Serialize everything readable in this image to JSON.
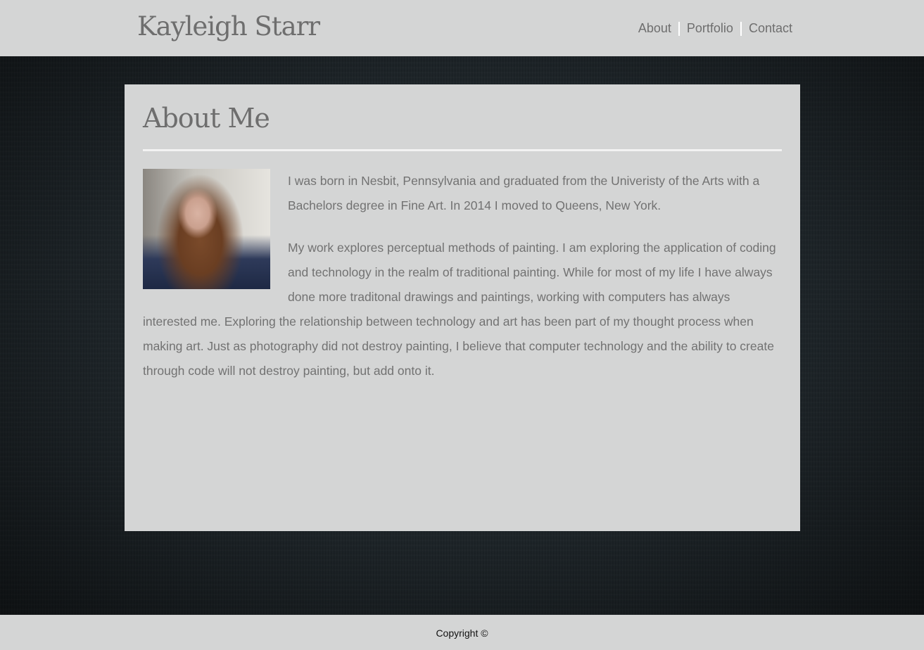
{
  "header": {
    "site_title": "Kayleigh Starr",
    "nav": [
      "About",
      "Portfolio",
      "Contact"
    ]
  },
  "about": {
    "heading": "About Me",
    "paragraphs": [
      "I was born in Nesbit, Pennsylvania and graduated from the Univeristy of the Arts with a Bachelors degree in Fine Art. In 2014 I moved to Queens, New York.",
      "My work explores perceptual methods of painting. I am exploring the application of coding and technology in the realm of traditional painting. While for most of my life I have always done more traditonal drawings and paintings, working with computers has always interested me. Exploring the relationship between technology and art has been part of my thought process when making art. Just as photography did not destroy painting, I believe that computer technology and the ability to create through code will not destroy painting, but add onto it."
    ]
  },
  "footer": {
    "copyright": "Copyright ©"
  },
  "colors": {
    "panel": "#d4d5d5",
    "text": "#6e6e6e",
    "background": "#1e2529"
  }
}
